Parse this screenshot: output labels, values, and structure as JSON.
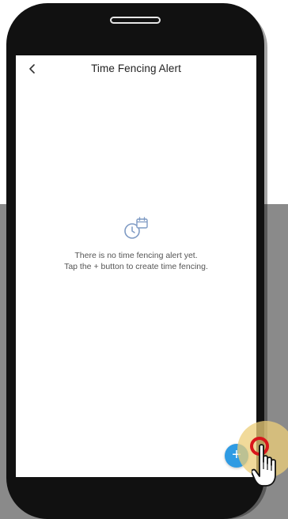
{
  "header": {
    "title": "Time Fencing Alert",
    "back_icon": "chevron-left-icon"
  },
  "empty_state": {
    "icon": "clock-calendar-icon",
    "line1": "There is no time fencing alert yet.",
    "line2": "Tap the + button to create time fencing."
  },
  "fab": {
    "label": "+",
    "color": "#2f9be3"
  },
  "colors": {
    "accent": "#2f9be3",
    "touch_ring": "#d8151b",
    "phone_frame": "#111111"
  }
}
